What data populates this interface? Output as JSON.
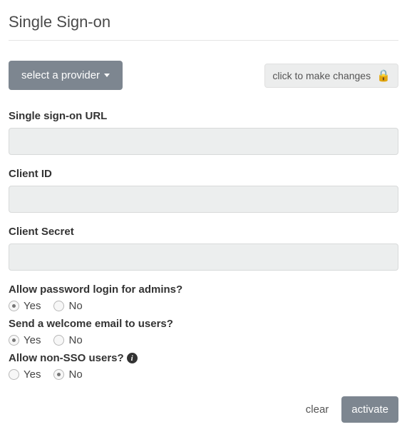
{
  "title": "Single Sign-on",
  "toolbar": {
    "provider_dropdown_label": "select a provider",
    "lock_label": "click to make changes"
  },
  "fields": {
    "sso_url": {
      "label": "Single sign-on URL",
      "value": ""
    },
    "client_id": {
      "label": "Client ID",
      "value": ""
    },
    "client_secret": {
      "label": "Client Secret",
      "value": ""
    }
  },
  "questions": {
    "admin_password": {
      "label": "Allow password login for admins?",
      "yes": "Yes",
      "no": "No",
      "selected": "yes"
    },
    "welcome_email": {
      "label": "Send a welcome email to users?",
      "yes": "Yes",
      "no": "No",
      "selected": "yes"
    },
    "non_sso": {
      "label": "Allow non-SSO users?",
      "yes": "Yes",
      "no": "No",
      "selected": "no"
    }
  },
  "footer": {
    "clear": "clear",
    "activate": "activate"
  }
}
